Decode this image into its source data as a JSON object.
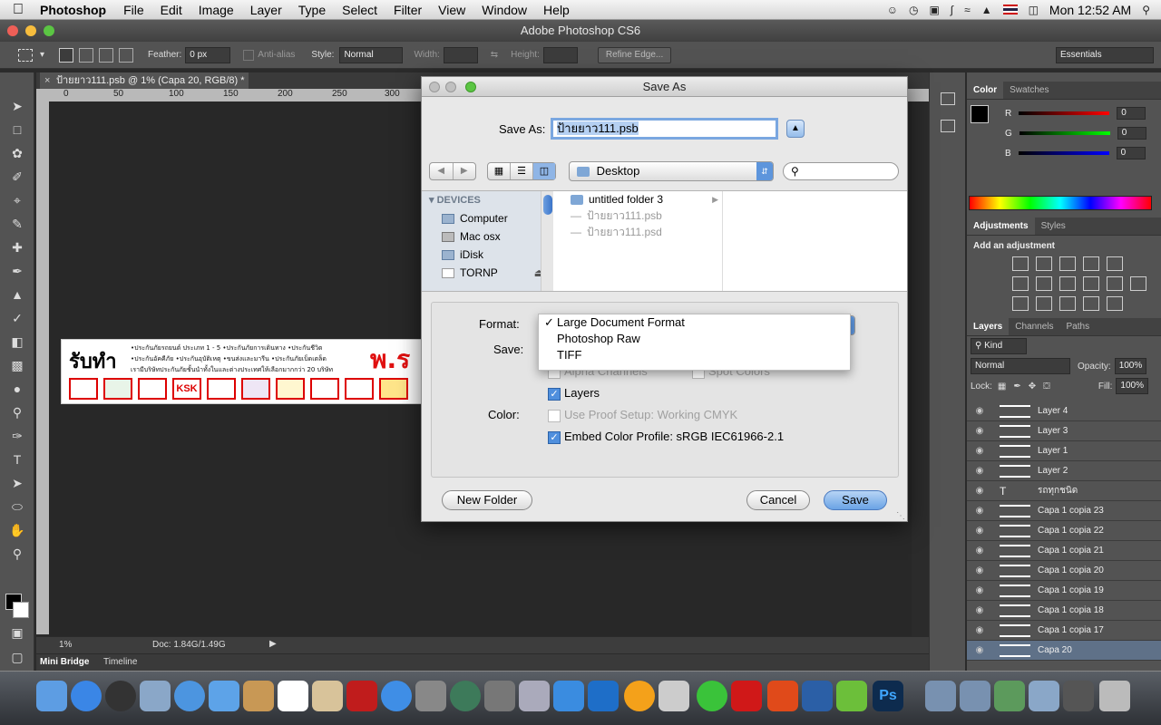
{
  "menubar": {
    "app": "Photoshop",
    "items": [
      "File",
      "Edit",
      "Image",
      "Layer",
      "Type",
      "Select",
      "Filter",
      "View",
      "Window",
      "Help"
    ],
    "clock": "Mon 12:52 AM"
  },
  "ps": {
    "window_title": "Adobe Photoshop CS6",
    "workspace": "Essentials",
    "options": {
      "feather_label": "Feather:",
      "feather_value": "0 px",
      "antialias": "Anti-alias",
      "style_label": "Style:",
      "style_value": "Normal",
      "width_label": "Width:",
      "height_label": "Height:",
      "refine_edge": "Refine Edge..."
    },
    "doc_tab": "ป้ายยาว111.psb @ 1% (Capa 20, RGB/8) *",
    "ruler_ticks": [
      "0",
      "50",
      "100",
      "150",
      "200",
      "250",
      "300"
    ],
    "status": {
      "zoom": "1%",
      "doc": "Doc: 1.84G/1.49G"
    },
    "bottom_tabs": [
      "Mini Bridge",
      "Timeline"
    ],
    "banner": {
      "heading": "รับทำ",
      "big": "พ.ร",
      "line1": "•ประกันภัยรถยนต์ ประเภท 1 - 5  •ประกันภัยการเดินทาง  •ประกันชีวิต",
      "line2": "•ประกันอัคคีภัย  •ประกันอุบัติเหตุ  •ขนส่งและมารีน  •ประกันภัยเบ็ดเตล็ด",
      "line3": "เรามีบริษัทประกันภัยชั้นนำทั้งในและต่างประเทศให้เลือกมากกว่า 20 บริษัท",
      "logo_text": "KSK"
    }
  },
  "right_panel": {
    "color_tabs": [
      "Color",
      "Swatches"
    ],
    "rgb": [
      {
        "label": "R",
        "value": "0"
      },
      {
        "label": "G",
        "value": "0"
      },
      {
        "label": "B",
        "value": "0"
      }
    ],
    "adj_tabs": [
      "Adjustments",
      "Styles"
    ],
    "adj_title": "Add an adjustment",
    "layers_tabs": [
      "Layers",
      "Channels",
      "Paths"
    ],
    "kind": "Kind",
    "blend": "Normal",
    "opacity_label": "Opacity:",
    "opacity": "100%",
    "lock_label": "Lock:",
    "fill_label": "Fill:",
    "fill": "100%",
    "layers": [
      "Layer 4",
      "Layer 3",
      "Layer 1",
      "Layer 2",
      "รถทุกชนิด",
      "Capa 1 copia 23",
      "Capa 1 copia 22",
      "Capa 1 copia 21",
      "Capa 1 copia 20",
      "Capa 1 copia 19",
      "Capa 1 copia 18",
      "Capa 1 copia 17",
      "Capa 20"
    ]
  },
  "dialog": {
    "title": "Save As",
    "save_as_label": "Save As:",
    "filename": "ป้ายยาว111.psb",
    "location": "Desktop",
    "devices_header": "DEVICES",
    "devices": [
      "Computer",
      "Mac osx",
      "iDisk",
      "TORNP"
    ],
    "files": [
      "untitled folder 3",
      "ป้ายยาว111.psb",
      "ป้ายยาว111.psd"
    ],
    "format_label": "Format:",
    "save_label": "Save:",
    "color_label": "Color:",
    "format_options": [
      "Large Document Format",
      "Photoshop Raw",
      "TIFF"
    ],
    "alpha_channels": "Alpha Channels",
    "spot_colors": "Spot Colors",
    "layers": "Layers",
    "use_proof": "Use Proof Setup:  Working CMYK",
    "embed_profile": "Embed Color Profile:  sRGB IEC61966-2.1",
    "new_folder": "New Folder",
    "cancel": "Cancel",
    "save": "Save"
  },
  "colors": {
    "accent": "#4f8fdd",
    "ps_bg": "#535353",
    "canvas": "#282828"
  }
}
